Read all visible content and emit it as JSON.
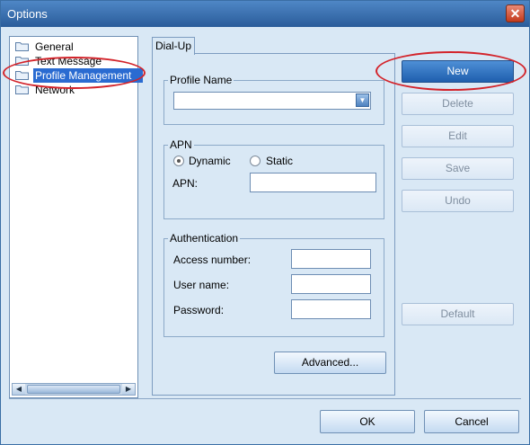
{
  "window": {
    "title": "Options",
    "close_glyph": "✕"
  },
  "nav": {
    "items": [
      {
        "label": "General",
        "icon": "folder-icon",
        "selected": false
      },
      {
        "label": "Text Message",
        "icon": "folder-icon",
        "selected": false
      },
      {
        "label": "Profile Management",
        "icon": "folder-icon",
        "selected": true
      },
      {
        "label": "Network",
        "icon": "folder-icon",
        "selected": false
      }
    ]
  },
  "tab": {
    "label": "Dial-Up"
  },
  "profile": {
    "legend": "Profile Name",
    "value": ""
  },
  "apn": {
    "legend": "APN",
    "dynamic_label": "Dynamic",
    "static_label": "Static",
    "selected": "Dynamic",
    "field_label": "APN:",
    "value": ""
  },
  "auth": {
    "legend": "Authentication",
    "access_label": "Access number:",
    "access_value": "",
    "user_label": "User name:",
    "user_value": "",
    "password_label": "Password:",
    "password_value": ""
  },
  "buttons": {
    "advanced": "Advanced...",
    "new": "New",
    "delete": "Delete",
    "edit": "Edit",
    "save": "Save",
    "undo": "Undo",
    "default": "Default",
    "ok": "OK",
    "cancel": "Cancel"
  },
  "colors": {
    "accent": "#2a6bd1",
    "annotation": "#d3232a",
    "background": "#d9e8f5"
  }
}
